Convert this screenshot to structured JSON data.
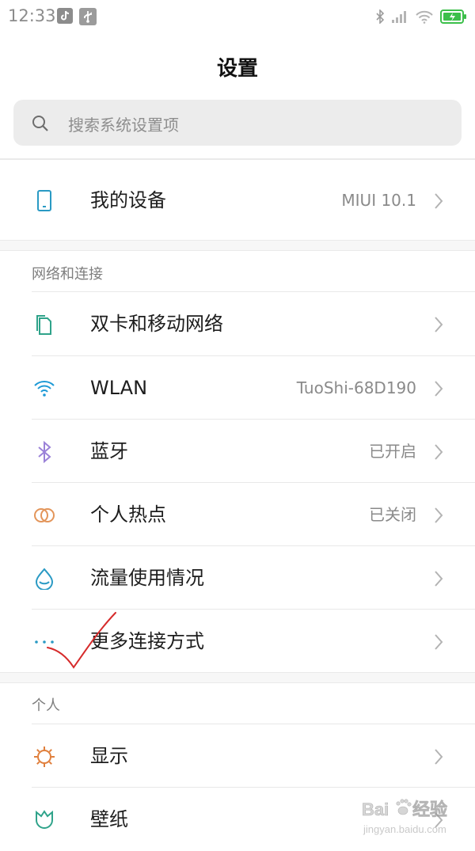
{
  "status_bar": {
    "time": "12:33",
    "left_icons": [
      "tiktok-icon",
      "usb-icon"
    ],
    "right_icons": [
      "bluetooth-icon",
      "signal-icon",
      "wifi-icon",
      "battery-icon"
    ]
  },
  "header": {
    "title": "设置"
  },
  "search": {
    "placeholder": "搜索系统设置项"
  },
  "my_device": {
    "label": "我的设备",
    "value": "MIUI 10.1",
    "icon": "phone-icon"
  },
  "sections": [
    {
      "label": "网络和连接",
      "items": [
        {
          "label": "双卡和移动网络",
          "value": "",
          "icon": "sim-cards-icon",
          "color": "#2fa38a"
        },
        {
          "label": "WLAN",
          "value": "TuoShi-68D190",
          "icon": "wifi-icon",
          "color": "#1e9ad6"
        },
        {
          "label": "蓝牙",
          "value": "已开启",
          "icon": "bluetooth-icon",
          "color": "#9b82d8"
        },
        {
          "label": "个人热点",
          "value": "已关闭",
          "icon": "hotspot-icon",
          "color": "#e3955a"
        },
        {
          "label": "流量使用情况",
          "value": "",
          "icon": "water-drop-icon",
          "color": "#2a9ac4"
        },
        {
          "label": "更多连接方式",
          "value": "",
          "icon": "more-dots-icon",
          "color": "#2a9ac4"
        }
      ]
    },
    {
      "label": "个人",
      "items": [
        {
          "label": "显示",
          "value": "",
          "icon": "sun-icon",
          "color": "#e07f3c"
        },
        {
          "label": "壁纸",
          "value": "",
          "icon": "tulip-icon",
          "color": "#2fa38a"
        }
      ]
    }
  ],
  "watermark": {
    "icon": "baidu-paw-icon",
    "brand": "Baidu",
    "brand_cn": "经验",
    "url": "jingyan.baidu.com"
  },
  "colors": {
    "accent_annotation": "#d62b2b",
    "section_bg": "#f7f7f7",
    "search_bg": "#ececec"
  }
}
